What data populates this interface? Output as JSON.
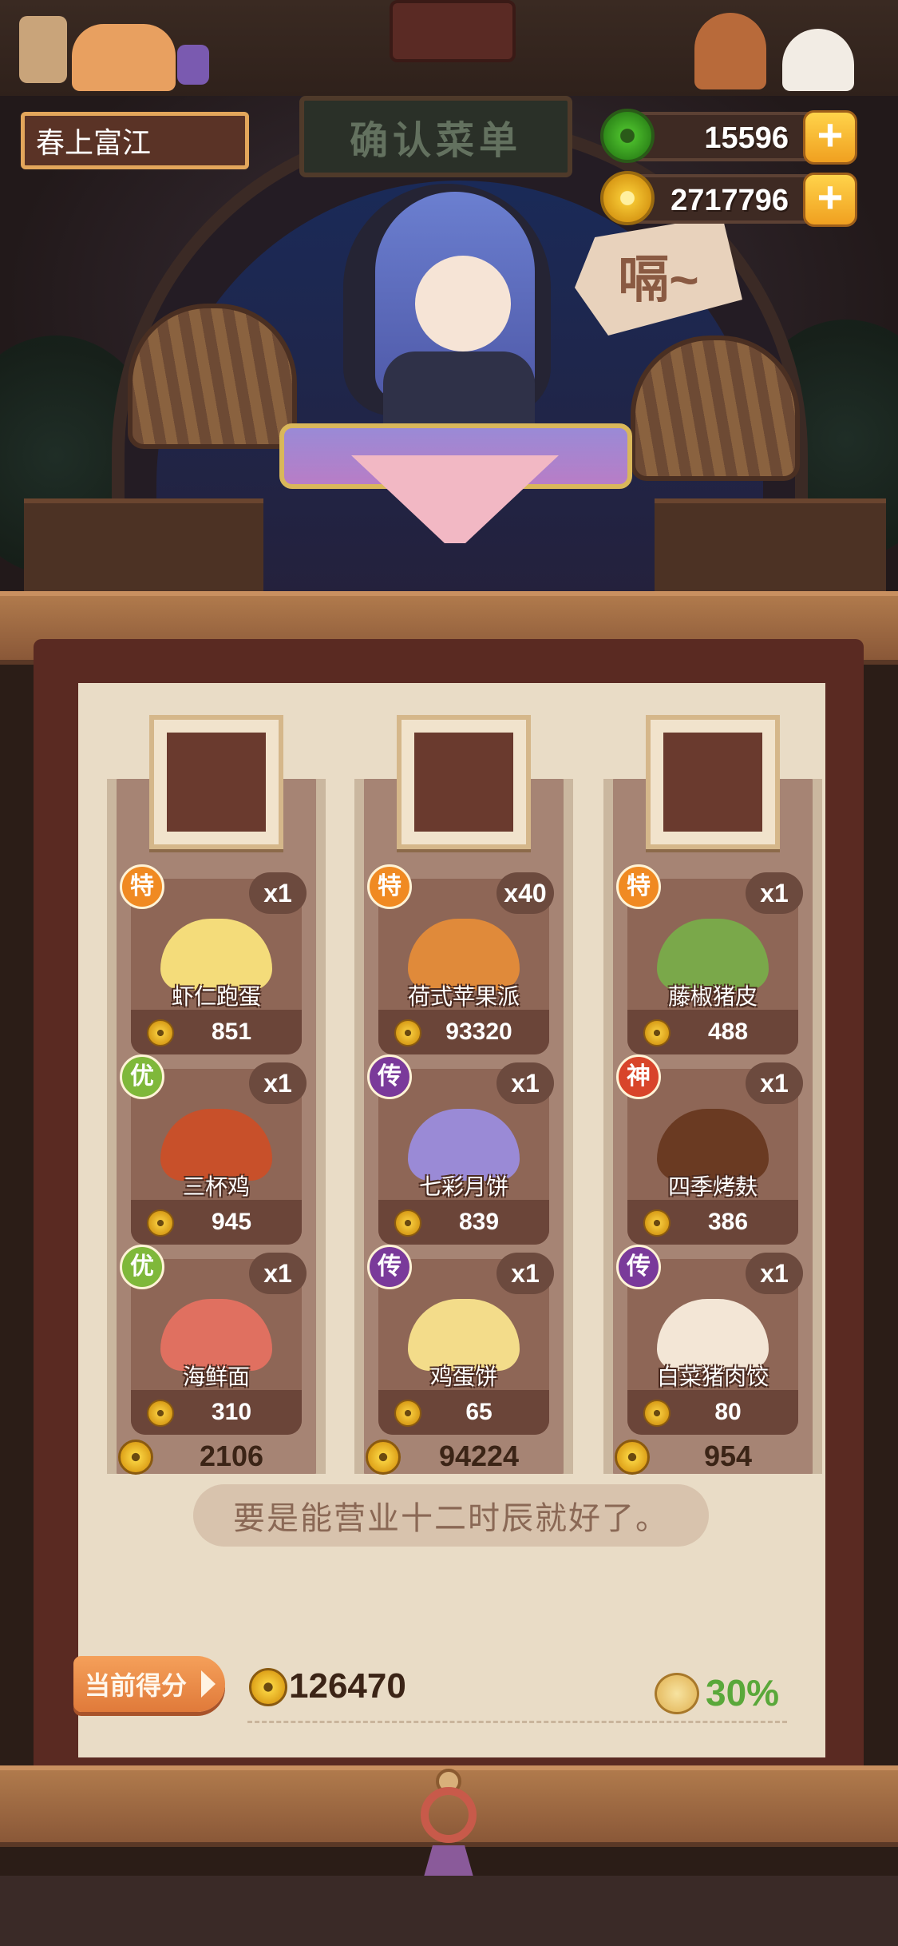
{
  "header": {
    "player_name": "春上富江",
    "sign_text": "确认菜单",
    "speech_text": "嗝~"
  },
  "currencies": {
    "jade": {
      "value": "15596",
      "icon": "jade-icon",
      "color": "#49b82a"
    },
    "coins": {
      "value": "2717796",
      "icon": "coin-icon",
      "color": "#f2c230"
    }
  },
  "grade_colors": {
    "特": "#f08a22",
    "优": "#7fb83a",
    "传": "#7a3a9a",
    "神": "#d8452a"
  },
  "columns": [
    {
      "customer": "white-haired-girl-avatar",
      "total": "2106",
      "dishes": [
        {
          "grade": "特",
          "qty": "x1",
          "name": "虾仁跑蛋",
          "price": "851",
          "food_color": "#f4dc7a"
        },
        {
          "grade": "优",
          "qty": "x1",
          "name": "三杯鸡",
          "price": "945",
          "food_color": "#c8502a"
        },
        {
          "grade": "优",
          "qty": "x1",
          "name": "海鲜面",
          "price": "310",
          "food_color": "#e07060"
        }
      ]
    },
    {
      "customer": "black-beast-avatar",
      "total": "94224",
      "dishes": [
        {
          "grade": "特",
          "qty": "x40",
          "name": "荷式苹果派",
          "price": "93320",
          "food_color": "#e08a3a"
        },
        {
          "grade": "传",
          "qty": "x1",
          "name": "七彩月饼",
          "price": "839",
          "food_color": "#9a8ad6"
        },
        {
          "grade": "传",
          "qty": "x1",
          "name": "鸡蛋饼",
          "price": "65",
          "food_color": "#f3dc8a"
        }
      ]
    },
    {
      "customer": "red-hat-boy-avatar",
      "total": "954",
      "dishes": [
        {
          "grade": "特",
          "qty": "x1",
          "name": "藤椒猪皮",
          "price": "488",
          "food_color": "#7aa84a"
        },
        {
          "grade": "神",
          "qty": "x1",
          "name": "四季烤麸",
          "price": "386",
          "food_color": "#6a3a22"
        },
        {
          "grade": "传",
          "qty": "x1",
          "name": "白菜猪肉饺",
          "price": "80",
          "food_color": "#f3e6d6"
        }
      ]
    }
  ],
  "message": "要是能营业十二时辰就好了。",
  "score": {
    "label": "当前得分",
    "value": "126470",
    "bonus": "30%",
    "bonus_icon": "fortune-bag-icon"
  }
}
